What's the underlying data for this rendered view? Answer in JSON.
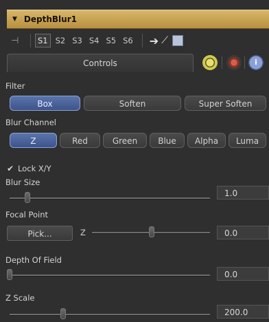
{
  "header": {
    "title": "DepthBlur1"
  },
  "versions": [
    "S1",
    "S2",
    "S3",
    "S4",
    "S5",
    "S6"
  ],
  "active_version": "S1",
  "tabs": {
    "controls": "Controls",
    "info_glyph": "i"
  },
  "filter": {
    "label": "Filter",
    "options": [
      "Box",
      "Soften",
      "Super Soften"
    ],
    "selected": "Box"
  },
  "blur_channel": {
    "label": "Blur Channel",
    "options": [
      "Z",
      "Red",
      "Green",
      "Blue",
      "Alpha",
      "Luma"
    ],
    "selected": "Z"
  },
  "lock_xy": {
    "label": "Lock X/Y",
    "checked": true
  },
  "blur_size": {
    "label": "Blur Size",
    "value": "1.0"
  },
  "focal_point": {
    "label": "Focal Point",
    "pick_label": "Pick...",
    "z_label": "Z",
    "value": "0.0"
  },
  "depth_of_field": {
    "label": "Depth Of Field",
    "value": "0.0"
  },
  "z_scale": {
    "label": "Z Scale",
    "value": "200.0"
  },
  "colors": {
    "header_gold": "#c9a352",
    "selected_blue": "#4a62a0",
    "background": "#2f2f2f"
  }
}
